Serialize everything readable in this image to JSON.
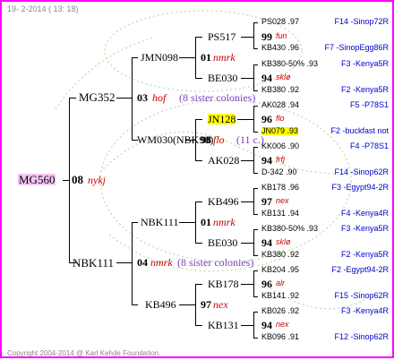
{
  "header": {
    "date": "19-  2-2014 ( 13: 18)"
  },
  "footer": {
    "copyright": "Copyright 2004-2014 @ Karl Kehde Foundation."
  },
  "root": {
    "name": "MG560",
    "gen": "08",
    "breeder": "nykj"
  },
  "g1": [
    {
      "name": "MG352"
    },
    {
      "name": "NBK111",
      "gen": "04",
      "breeder": "nmrk",
      "note": "(8 sister colonies)"
    }
  ],
  "g2": [
    {
      "name": "JMN098"
    },
    {
      "name": "WM030(NBK98)",
      "gen": "03",
      "breeder": "hof",
      "note": "(8 sister colonies)"
    },
    {
      "name": "NBK111"
    },
    {
      "name": "KB496"
    }
  ],
  "g3": [
    {
      "name": "PS517",
      "gen": "01",
      "breeder": "nmrk"
    },
    {
      "name": "BE030"
    },
    {
      "name": "JN128",
      "gen": "98",
      "breeder": "flo",
      "note": "(11 c.)"
    },
    {
      "name": "AK028"
    },
    {
      "name": "KB496",
      "gen": "01",
      "breeder": "nmrk"
    },
    {
      "name": "BE030"
    },
    {
      "name": "KB178",
      "gen": "97",
      "breeder": "nex"
    },
    {
      "name": "KB131"
    }
  ],
  "g4": [
    {
      "top": "PS028 .97",
      "top_r": "F14 -Sinop72R",
      "mid_n": "99",
      "mid_b": "fun",
      "bot": "KB430 .96",
      "bot_r": "F7 -SinopEgg86R"
    },
    {
      "top": "KB380-50% .93",
      "top_r": "F3 -Kenya5R",
      "mid_n": "94",
      "mid_b": "sklø",
      "bot": "KB380 .92",
      "bot_r": "F2 -Kenya5R"
    },
    {
      "top": "AK028 .94",
      "top_r": "F5 -P78S1",
      "mid_n": "96",
      "mid_b": "flo",
      "bot": "JN079 .93",
      "bot_r": "F2 -buckfast not"
    },
    {
      "top": "KK006 .90",
      "top_r": "F4 -P78S1",
      "mid_n": "94",
      "mid_b": "frfj",
      "bot": "D-342 .90",
      "bot_r": "F14 -Sinop62R"
    },
    {
      "top": "KB178 .96",
      "top_r": "F3 -Egypt94-2R",
      "mid_n": "97",
      "mid_b": "nex",
      "bot": "KB131 .94",
      "bot_r": "F4 -Kenya4R"
    },
    {
      "top": "KB380-50% .93",
      "top_r": "F3 -Kenya5R",
      "mid_n": "94",
      "mid_b": "sklø",
      "bot": "KB380 .92",
      "bot_r": "F2 -Kenya5R"
    },
    {
      "top": "KB204 .95",
      "top_r": "F2 -Egypt94-2R",
      "mid_n": "96",
      "mid_b": "alr",
      "bot": "KB141 .92",
      "bot_r": "F15 -Sinop62R"
    },
    {
      "top": "KB026 .92",
      "top_r": "F3 -Kenya4R",
      "mid_n": "94",
      "mid_b": "nex",
      "bot": "KB096 .91",
      "bot_r": "F12 -Sinop62R"
    }
  ]
}
